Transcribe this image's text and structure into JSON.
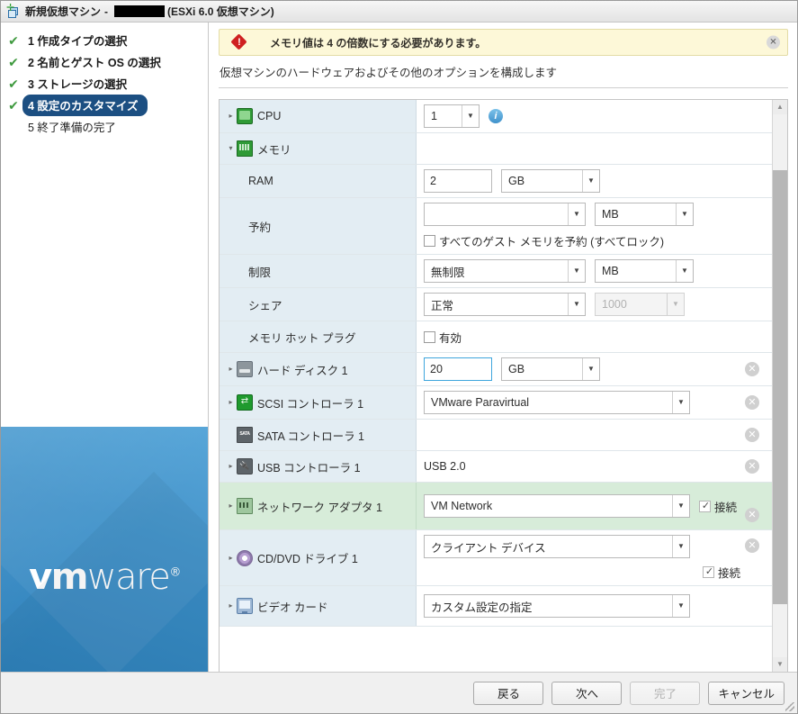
{
  "window": {
    "title_prefix": "新規仮想マシン",
    "title_dash": "-",
    "title_suffix": "(ESXi 6.0 仮想マシン)",
    "icon": "new-vm-icon"
  },
  "sidebar": {
    "steps": [
      {
        "number": "1",
        "label": "1 作成タイプの選択",
        "done": true,
        "active": false
      },
      {
        "number": "2",
        "label": "2 名前とゲスト OS の選択",
        "done": true,
        "active": false
      },
      {
        "number": "3",
        "label": "3 ストレージの選択",
        "done": true,
        "active": false
      },
      {
        "number": "4",
        "label": "4 設定のカスタマイズ",
        "done": true,
        "active": true
      },
      {
        "number": "5",
        "label": "5 終了準備の完了",
        "done": false,
        "active": false
      }
    ],
    "check_glyph": "✔",
    "brand": {
      "vm": "vm",
      "ware": "ware",
      "reg": "®"
    }
  },
  "banner": {
    "icon": "error-icon",
    "bang": "!",
    "message": "メモリ値は 4 の倍数にする必要があります。",
    "close_label": "✕",
    "bg_color": "#fdf8d8",
    "icon_color": "#cf2020"
  },
  "page": {
    "subtitle": "仮想マシンのハードウェアおよびその他のオプションを構成します"
  },
  "table": {
    "rows": {
      "cpu": {
        "label": "CPU",
        "icon": "cpu-icon",
        "twisty": "▸",
        "value": "1",
        "info_glyph": "i"
      },
      "memory": {
        "label": "メモリ",
        "icon": "memory-icon",
        "twisty": "▾"
      },
      "ram": {
        "label": "RAM",
        "value": "2",
        "unit": "GB"
      },
      "reservation": {
        "label": "予約",
        "value": "",
        "unit": "MB",
        "checkbox_label": "すべてのゲスト メモリを予約 (すべてロック)",
        "checked": false
      },
      "limit": {
        "label": "制限",
        "value": "無制限",
        "unit": "MB"
      },
      "shares": {
        "label": "シェア",
        "value": "正常",
        "amount": "1000",
        "amount_disabled": true
      },
      "hotplug": {
        "label": "メモリ ホット プラグ",
        "checkbox_label": "有効",
        "checked": false
      },
      "harddisk": {
        "label": "ハード ディスク 1",
        "icon": "harddisk-icon",
        "twisty": "▸",
        "value": "20",
        "unit": "GB",
        "remove_glyph": "✕"
      },
      "scsi": {
        "label": "SCSI コントローラ 1",
        "icon": "scsi-icon",
        "twisty": "▸",
        "value": "VMware Paravirtual",
        "remove_glyph": "✕"
      },
      "sata": {
        "label": "SATA コントローラ 1",
        "icon": "sata-icon",
        "twisty": "",
        "value": "",
        "remove_glyph": "✕"
      },
      "usb": {
        "label": "USB コントローラ 1",
        "icon": "usb-icon",
        "twisty": "▸",
        "value": "USB 2.0",
        "remove_glyph": "✕"
      },
      "network": {
        "label": "ネットワーク アダプタ 1",
        "icon": "network-icon",
        "twisty": "▸",
        "value": "VM Network",
        "connect_label": "接続",
        "connected": true,
        "remove_glyph": "✕",
        "highlight_color": "#d7ecd9"
      },
      "cddvd": {
        "label": "CD/DVD ドライブ 1",
        "icon": "cd-dvd-icon",
        "twisty": "▸",
        "value": "クライアント デバイス",
        "connect_label": "接続",
        "connected": true,
        "remove_glyph": "✕"
      },
      "video": {
        "label": "ビデオ カード",
        "icon": "video-card-icon",
        "twisty": "▸",
        "value": "カスタム設定の指定"
      }
    },
    "arrow_glyph": "▼",
    "scrollbar": {
      "up_glyph": "▲",
      "down_glyph": "▼"
    }
  },
  "footer": {
    "back": "戻る",
    "next": "次へ",
    "finish": "完了",
    "finish_disabled": true,
    "cancel": "キャンセル"
  }
}
